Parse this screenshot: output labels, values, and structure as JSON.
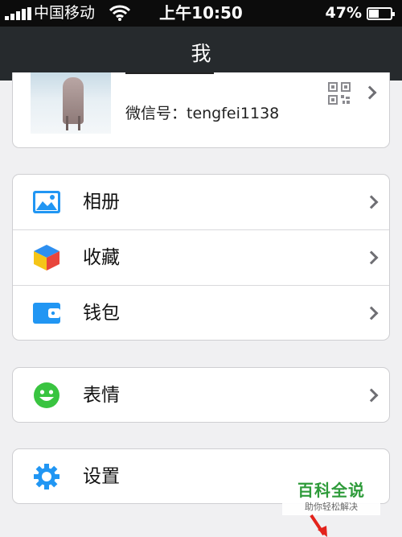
{
  "status_bar": {
    "carrier": "中国移动",
    "time": "上午10:50",
    "battery": "47%"
  },
  "nav": {
    "title": "我"
  },
  "profile": {
    "wechat_id": "微信号：tengfei1138"
  },
  "menu_groups": [
    {
      "items": [
        {
          "label": "相册",
          "icon": "album-icon"
        },
        {
          "label": "收藏",
          "icon": "favorites-icon"
        },
        {
          "label": "钱包",
          "icon": "wallet-icon"
        }
      ]
    },
    {
      "items": [
        {
          "label": "表情",
          "icon": "sticker-smiley-icon"
        }
      ]
    },
    {
      "items": [
        {
          "label": "设置",
          "icon": "gear-icon"
        }
      ]
    }
  ],
  "watermark": {
    "title": "百科全说",
    "subtitle": "助你轻松解决"
  },
  "colors": {
    "nav_bg": "#262a2d",
    "accent_blue": "#2196f3",
    "accent_green": "#39c440",
    "watermark_green": "#2e9b3a"
  }
}
